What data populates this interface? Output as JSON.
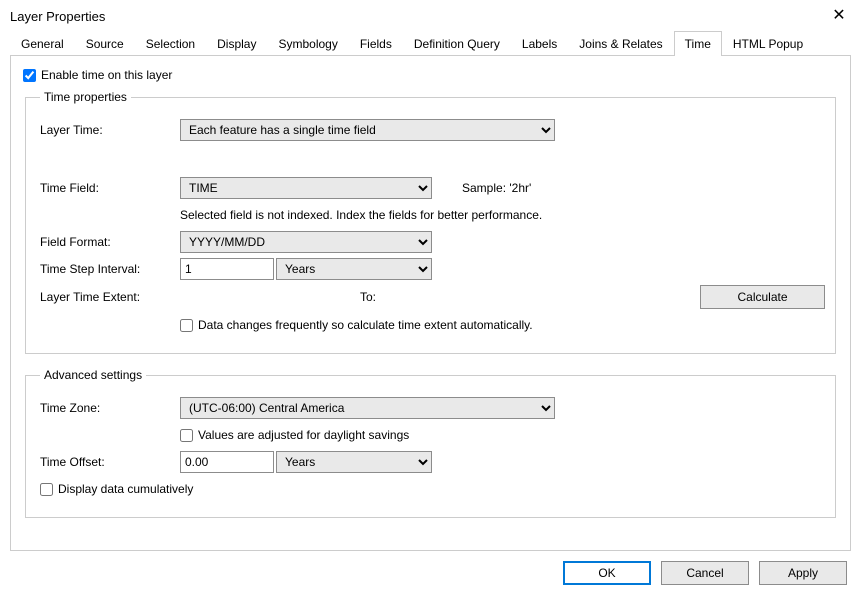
{
  "window": {
    "title": "Layer Properties"
  },
  "tabs": [
    "General",
    "Source",
    "Selection",
    "Display",
    "Symbology",
    "Fields",
    "Definition Query",
    "Labels",
    "Joins & Relates",
    "Time",
    "HTML Popup"
  ],
  "active_tab": "Time",
  "enable_time_label": "Enable time on this layer",
  "tp": {
    "legend": "Time properties",
    "layer_time_label": "Layer Time:",
    "layer_time_value": "Each feature has a single time field",
    "time_field_label": "Time Field:",
    "time_field_value": "TIME",
    "sample_label": "Sample: '2hr'",
    "index_warning": "Selected field is not indexed. Index the fields for better performance.",
    "field_format_label": "Field Format:",
    "field_format_value": "YYYY/MM/DD",
    "time_step_label": "Time Step Interval:",
    "time_step_value": "1",
    "time_step_unit": "Years",
    "layer_extent_label": "Layer Time Extent:",
    "to_label": "To:",
    "calculate_btn": "Calculate",
    "auto_calc_label": "Data changes frequently so calculate time extent automatically."
  },
  "adv": {
    "legend": "Advanced settings",
    "timezone_label": "Time Zone:",
    "timezone_value": "(UTC-06:00) Central America",
    "dst_label": "Values are adjusted for daylight savings",
    "offset_label": "Time Offset:",
    "offset_value": "0.00",
    "offset_unit": "Years",
    "cumulative_label": "Display data cumulatively"
  },
  "footer": {
    "ok": "OK",
    "cancel": "Cancel",
    "apply": "Apply"
  }
}
